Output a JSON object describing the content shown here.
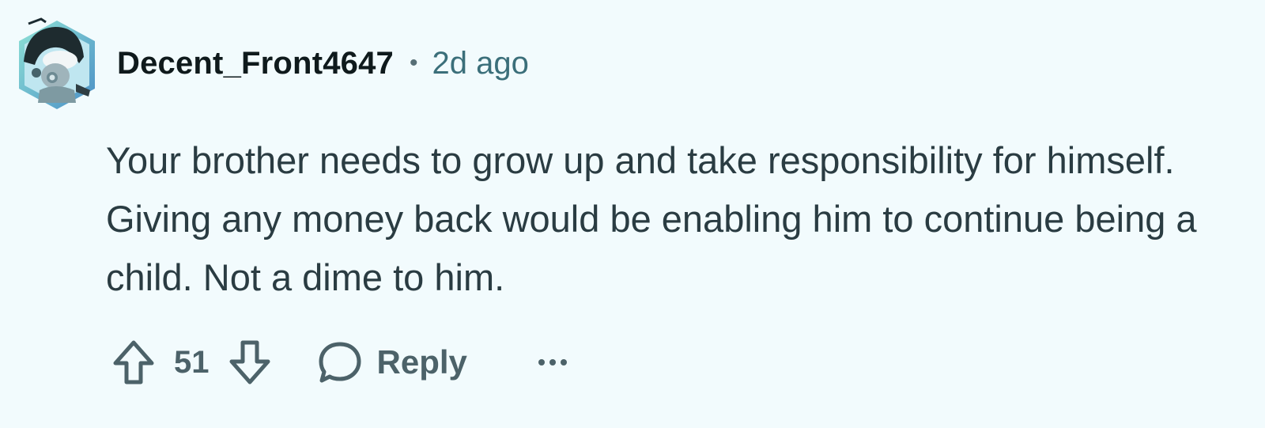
{
  "comment": {
    "author": "Decent_Front4647",
    "separator": "•",
    "timestamp": "2d ago",
    "body": "Your brother needs to grow up and take responsibility for himself. Giving any money back would be enabling him to continue being a child. Not a dime to him."
  },
  "actions": {
    "upvote_icon": "arrow-up-icon",
    "score": "51",
    "downvote_icon": "arrow-down-icon",
    "reply_icon": "speech-bubble-icon",
    "reply_label": "Reply",
    "more_icon": "ellipsis-icon"
  },
  "colors": {
    "background": "#f2fbfd",
    "username": "#0f1a1c",
    "timestamp": "#3b6f7a",
    "body": "#2a3c42",
    "actions": "#4c6269"
  }
}
